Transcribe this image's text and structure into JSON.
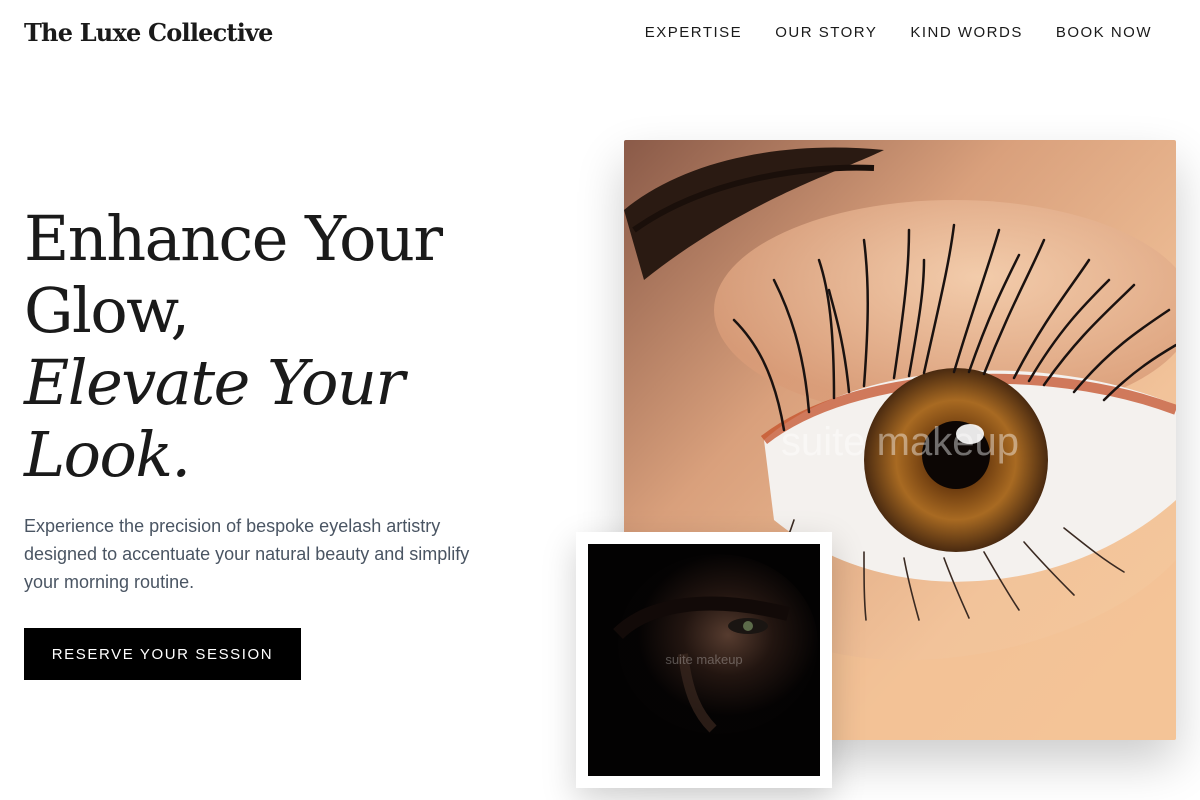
{
  "header": {
    "brand": "The Luxe Collective",
    "nav": [
      {
        "label": "EXPERTISE"
      },
      {
        "label": "OUR STORY"
      },
      {
        "label": "KIND WORDS"
      },
      {
        "label": "BOOK NOW"
      }
    ]
  },
  "hero": {
    "title_line1": "Enhance Your",
    "title_line2": "Glow,",
    "title_italic1": "Elevate Your",
    "title_italic2": "Look.",
    "description": "Experience the precision of bespoke eyelash artistry designed to accentuate your natural beauty and simplify your morning routine.",
    "cta_label": "RESERVE YOUR SESSION"
  },
  "images": {
    "main_watermark": "suite makeup",
    "inset_watermark": "suite makeup"
  }
}
